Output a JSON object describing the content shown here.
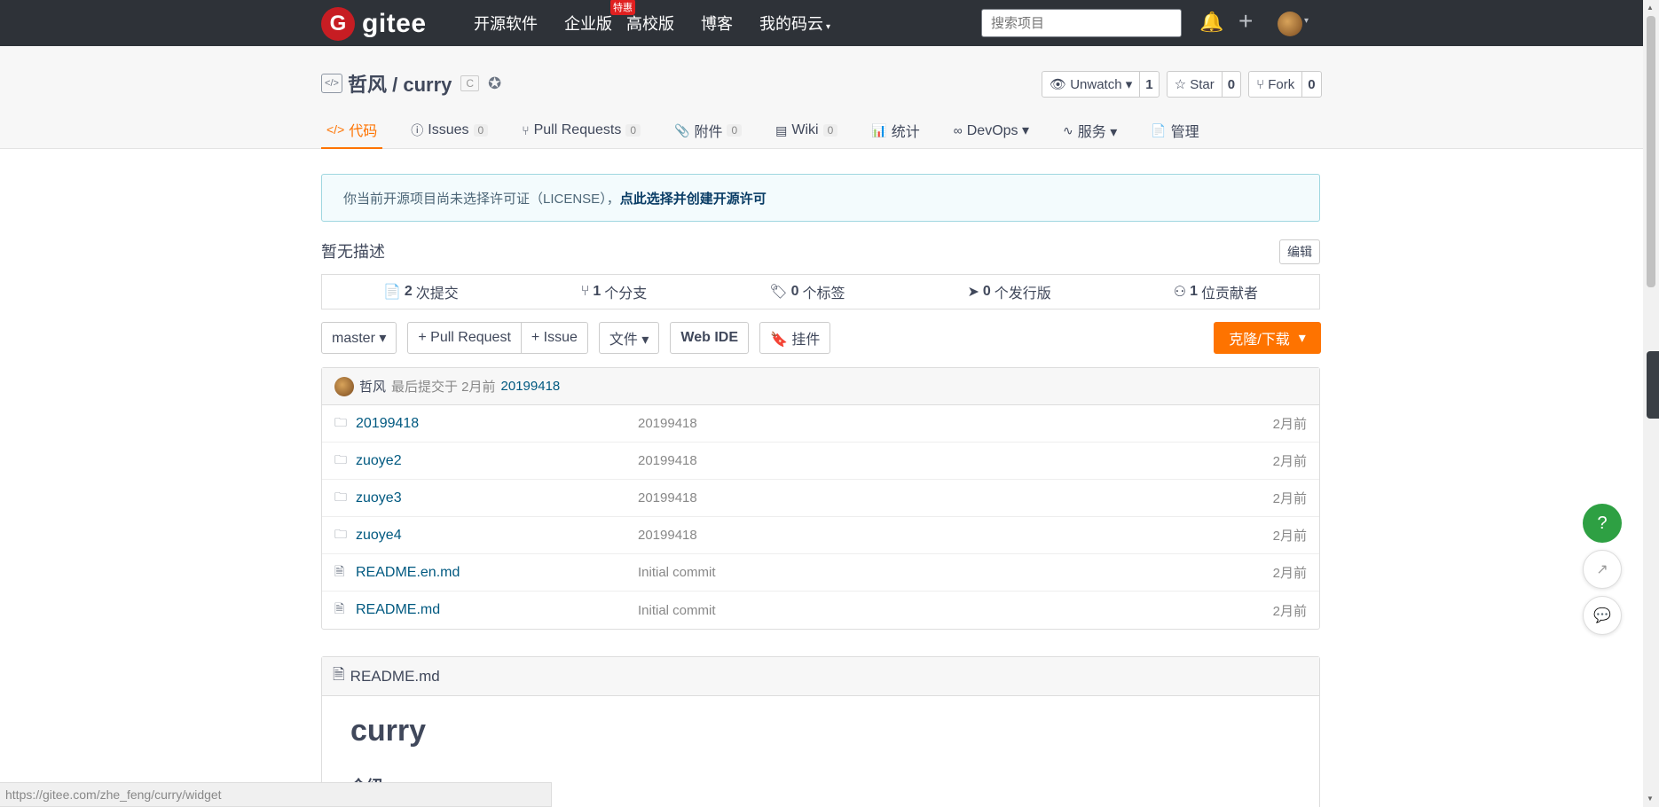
{
  "topbar": {
    "logo_mark": "G",
    "logo_text": "gitee",
    "nav": [
      {
        "label": "开源软件"
      },
      {
        "label": "企业版",
        "promo": "特惠"
      },
      {
        "label": "高校版"
      },
      {
        "label": "博客"
      },
      {
        "label": "我的码云",
        "caret": "▾"
      }
    ],
    "search_placeholder": "搜索项目",
    "bell_icon": "🔔",
    "plus_icon": "+",
    "avatar_caret": "▾"
  },
  "repo": {
    "icon": "</>",
    "title": "哲风 / curry",
    "badge": "C",
    "extra_icon": "✪",
    "actions": [
      {
        "label": "👁 Unwatch ▾",
        "count": "1"
      },
      {
        "label": "☆ Star",
        "count": "0"
      },
      {
        "label": "⑂ Fork",
        "count": "0"
      }
    ],
    "tabs": [
      {
        "icon": "</>",
        "label": "代码",
        "count": ""
      },
      {
        "icon": "ⓘ",
        "label": "Issues",
        "count": "0"
      },
      {
        "icon": "⑂",
        "label": "Pull Requests",
        "count": "0"
      },
      {
        "icon": "📎",
        "label": "附件",
        "count": "0"
      },
      {
        "icon": "▤",
        "label": "Wiki",
        "count": "0"
      },
      {
        "icon": "📊",
        "label": "统计",
        "count": ""
      },
      {
        "icon": "∞",
        "label": "DevOps ▾",
        "count": ""
      },
      {
        "icon": "∿",
        "label": "服务 ▾",
        "count": ""
      },
      {
        "icon": "📄",
        "label": "管理",
        "count": ""
      }
    ]
  },
  "notice": {
    "text": "你当前开源项目尚未选择许可证（LICENSE），",
    "link": "点此选择并创建开源许可"
  },
  "description": "暂无描述",
  "edit_label": "编辑",
  "stats": [
    {
      "icon": "📄",
      "value": "2",
      "label": "次提交"
    },
    {
      "icon": "⑂",
      "value": "1",
      "label": "个分支"
    },
    {
      "icon": "🏷",
      "value": "0",
      "label": "个标签"
    },
    {
      "icon": "➤",
      "value": "0",
      "label": "个发行版"
    },
    {
      "icon": "⚇",
      "value": "1",
      "label": "位贡献者"
    }
  ],
  "toolbar": {
    "branch": "master ▾",
    "pull_request": "+ Pull Request",
    "issue": "+ Issue",
    "file": "文件 ▾",
    "web_ide": "Web IDE",
    "widget": "🔖 挂件",
    "clone": "克隆/下载",
    "clone_caret": "▾"
  },
  "commit": {
    "author": "哲风",
    "meta": "最后提交于 2月前",
    "id": "20199418"
  },
  "files": [
    {
      "icon": "🗀",
      "name": "20199418",
      "msg": "20199418",
      "time": "2月前"
    },
    {
      "icon": "🗀",
      "name": "zuoye2",
      "msg": "20199418",
      "time": "2月前"
    },
    {
      "icon": "🗀",
      "name": "zuoye3",
      "msg": "20199418",
      "time": "2月前"
    },
    {
      "icon": "🗀",
      "name": "zuoye4",
      "msg": "20199418",
      "time": "2月前"
    },
    {
      "icon": "🗎",
      "name": "README.en.md",
      "msg": "Initial commit",
      "time": "2月前"
    },
    {
      "icon": "🗎",
      "name": "README.md",
      "msg": "Initial commit",
      "time": "2月前"
    }
  ],
  "readme": {
    "file_label": "README.md",
    "h1": "curry",
    "h2": "介绍"
  },
  "status_url": "https://gitee.com/zhe_feng/curry/widget",
  "float": {
    "help": "?",
    "share": "↗",
    "chat": "💬"
  },
  "colors": {
    "topbar": "#2e3238",
    "accent": "#fe7300",
    "brand": "#c71d23",
    "link": "#005980",
    "help": "#2ea043"
  }
}
